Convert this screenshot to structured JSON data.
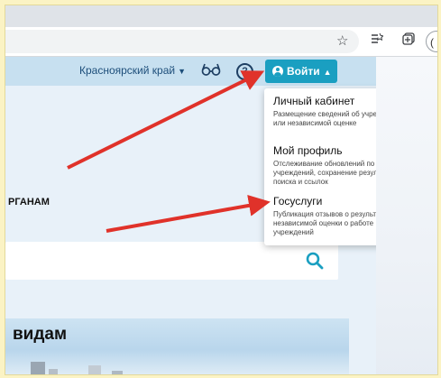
{
  "browser": {
    "toolbar_icons": [
      "star-icon",
      "reading-list-icon",
      "collections-icon"
    ],
    "profile_label": "("
  },
  "header": {
    "region_label": "Красноярский край",
    "login_label": "Войти"
  },
  "page": {
    "section_heading": "РГАНАМ",
    "hero_title": "видам"
  },
  "dropdown": {
    "items": [
      {
        "title": "Личный кабинет",
        "description": "Размещение сведений об учреждении или независимой оценке"
      },
      {
        "title": "Мой профиль",
        "description": "Отслеживание обновлений по списку учреждений, сохранение результатов поиска и ссылок"
      },
      {
        "title": "Госуслуги",
        "description": "Публикация отзывов о результатах независимой оценки о работе учреждений"
      }
    ]
  },
  "colors": {
    "accent": "#1a9fc1",
    "annotation_arrow": "#e0322a",
    "outer_frame": "#fbf3c4"
  }
}
